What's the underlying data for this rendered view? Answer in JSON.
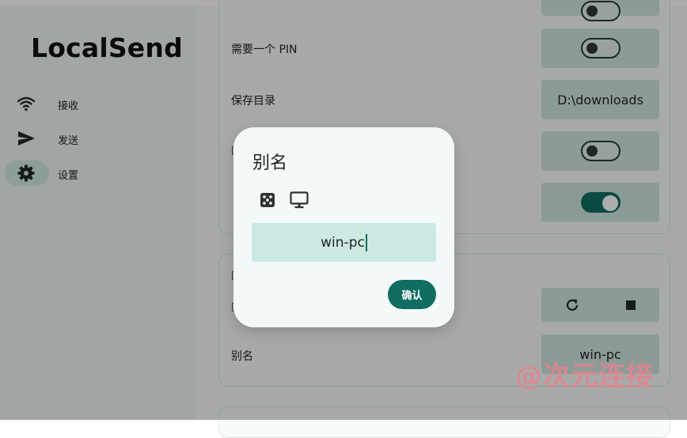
{
  "app": {
    "title": "LocalSend"
  },
  "sidebar": {
    "items": [
      {
        "label": "接收",
        "icon": "wifi-icon"
      },
      {
        "label": "发送",
        "icon": "send-icon"
      },
      {
        "label": "设置",
        "icon": "gear-icon",
        "active": true
      }
    ]
  },
  "settings": {
    "rows": [
      {
        "label": "需要一个 PIN",
        "control": "switch",
        "on": false
      },
      {
        "label": "保存目录",
        "control": "text",
        "value": "D:\\downloads"
      },
      {
        "label": "",
        "control": "switch",
        "on": false
      },
      {
        "label": "",
        "control": "switch",
        "on": true
      }
    ],
    "network_rows": [
      {
        "label": "",
        "control": "buttons"
      },
      {
        "label": "别名",
        "control": "text",
        "value": "win-pc"
      }
    ]
  },
  "dialog": {
    "title": "别名",
    "icons": [
      "dice-icon",
      "monitor-icon"
    ],
    "input_value": "win-pc",
    "confirm_label": "确认"
  },
  "watermark": "@次元连接",
  "colors": {
    "accent": "#0f6d62",
    "input_fill": "#cde9e3",
    "control_fill": "#cfe5e0"
  }
}
